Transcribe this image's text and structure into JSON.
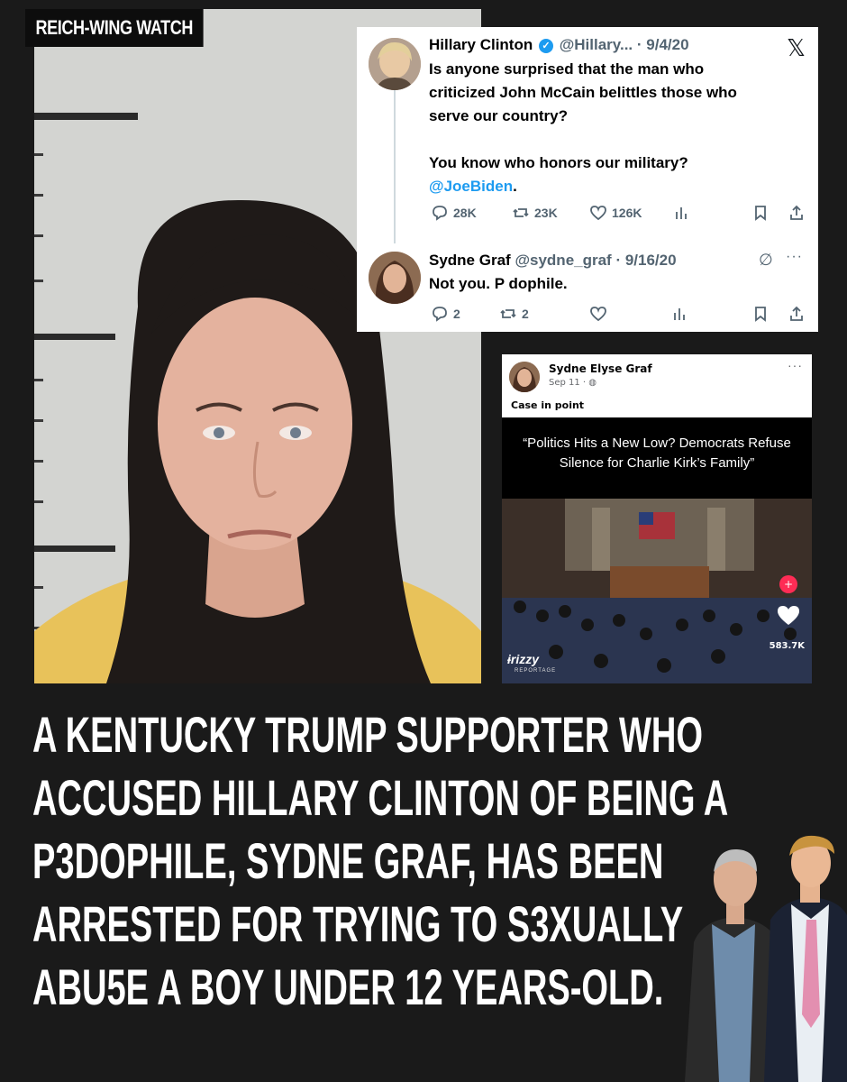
{
  "brand": {
    "tag": "REICH-WING WATCH"
  },
  "tweet_card": {
    "x_logo": "𝕏",
    "original": {
      "name": "Hillary Clinton",
      "meta": "@Hillary... · 9/4/20",
      "body_lines": [
        "Is anyone surprised that the man who",
        "criticized John McCain belittles those who",
        "serve our country?"
      ],
      "body_line2": "You know who honors our military?",
      "mention": "@JoeBiden",
      "mention_suffix": ".",
      "replies": "28K",
      "reposts": "23K",
      "likes": "126K"
    },
    "reply": {
      "name": "Sydne Graf",
      "meta": "@sydne_graf · 9/16/20",
      "text": "Not you. P  dophile.",
      "replies": "2",
      "reposts": "2"
    }
  },
  "facebook_post": {
    "name": "Sydne Elyse Graf",
    "meta": "Sep 11 · ",
    "caption": "Case in point",
    "headline_line1": "“Politics Hits a New Low? Democrats Refuse",
    "headline_line2": "Silence for Charlie Kirk’s Family”",
    "likes": "583.7K",
    "watermark": "ɨrizzy",
    "watermark_sub": "REPORTAGE"
  },
  "headline": {
    "lines": [
      "A KENTUCKY TRUMP SUPPORTER WHO",
      "ACCUSED HILLARY CLINTON OF BEING A",
      "P3DOPHILE, SYDNE GRAF, HAS BEEN",
      "ARRESTED FOR TRYING TO S3XUALLY",
      "ABU5E A BOY UNDER 12 YEARS-OLD."
    ]
  },
  "colors": {
    "background": "#1a1a1a",
    "link_blue": "#1d9bf0",
    "verified_blue": "#1d9bf0",
    "jumpsuit_yellow": "#e8c25a"
  }
}
